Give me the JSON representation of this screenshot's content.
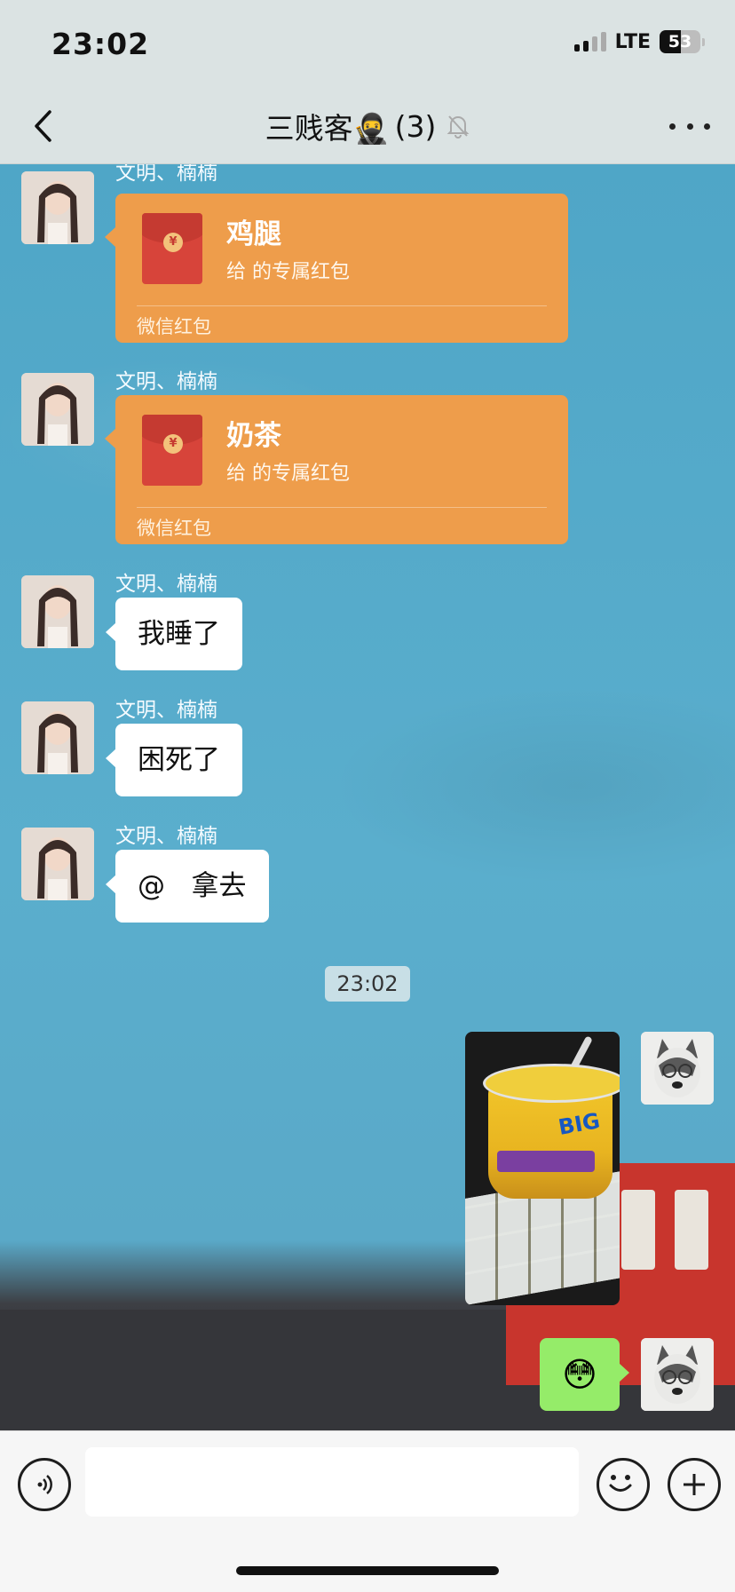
{
  "status_bar": {
    "time": "23:02",
    "network": "LTE",
    "battery": "53",
    "battery_level_percent": 53
  },
  "header": {
    "title": "三贱客🥷",
    "member_count": "(3)",
    "muted": true
  },
  "messages": [
    {
      "sender": "文明、楠楠",
      "type": "red-packet",
      "title": "鸡腿",
      "subtitle": "给   的专属红包",
      "footer": "微信红包"
    },
    {
      "sender": "文明、楠楠",
      "type": "red-packet",
      "title": "奶茶",
      "subtitle": "给   的专属红包",
      "footer": "微信红包"
    },
    {
      "sender": "文明、楠楠",
      "type": "text",
      "text": "我睡了"
    },
    {
      "sender": "文明、楠楠",
      "type": "text",
      "text": "困死了"
    },
    {
      "sender": "文明、楠楠",
      "type": "text",
      "text": "@   拿去"
    }
  ],
  "time_divider": "23:02",
  "outgoing": [
    {
      "type": "image",
      "description": "instant noodle cup photo"
    },
    {
      "type": "emoji",
      "emoji": "😳"
    }
  ],
  "input_bar": {
    "placeholder": "",
    "value": ""
  },
  "colors": {
    "red_packet": "#ee9d4b",
    "outgoing_bubble": "#95ec69",
    "chat_bg": "#5aaecd"
  }
}
